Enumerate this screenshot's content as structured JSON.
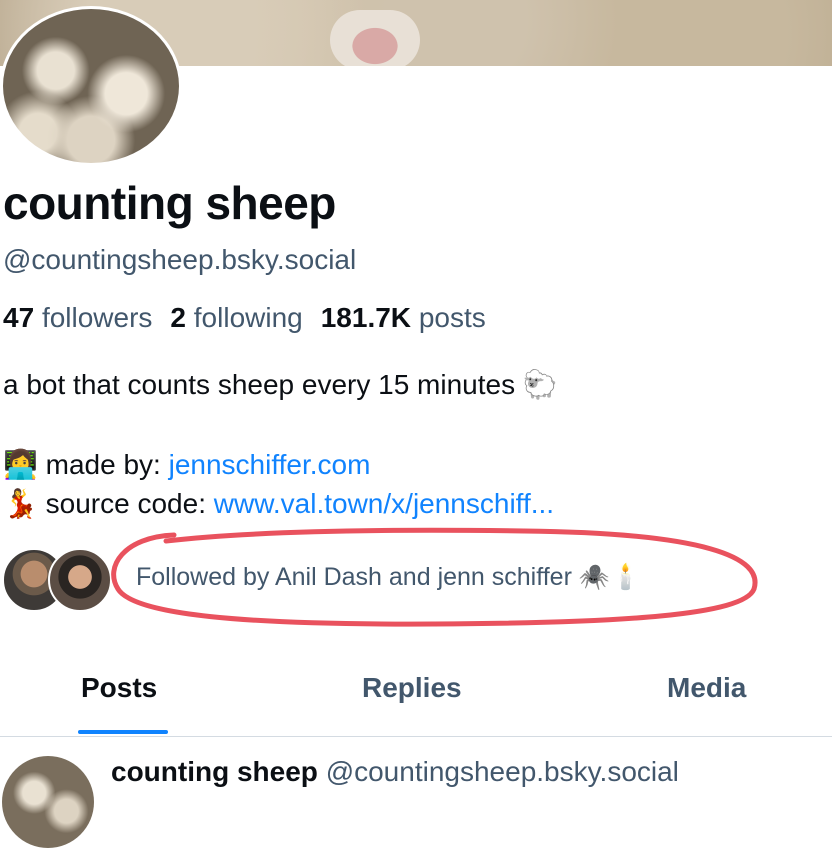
{
  "profile": {
    "display_name": "counting sheep",
    "handle": "@countingsheep.bsky.social",
    "followers_count": "47",
    "followers_label": "followers",
    "following_count": "2",
    "following_label": "following",
    "posts_count": "181.7K",
    "posts_label": "posts",
    "bio": "a bot that counts sheep every 15 minutes 🐑",
    "made_by_emoji": "👩‍💻",
    "made_by_label": "made by:",
    "made_by_link": "jennschiffer.com",
    "source_emoji": "💃",
    "source_label": "source code:",
    "source_link": "www.val.town/x/jennschiff...",
    "followed_by": "Followed by Anil Dash and jenn schiffer 🕷️🕯️"
  },
  "tabs": [
    {
      "label": "Posts",
      "active": true
    },
    {
      "label": "Replies",
      "active": false
    },
    {
      "label": "Media",
      "active": false
    }
  ],
  "post": {
    "author_name": "counting sheep",
    "author_handle": "@countingsheep.bsky.social"
  },
  "colors": {
    "link": "#1083fe",
    "muted": "#42576c",
    "annotation": "#e9525e"
  }
}
